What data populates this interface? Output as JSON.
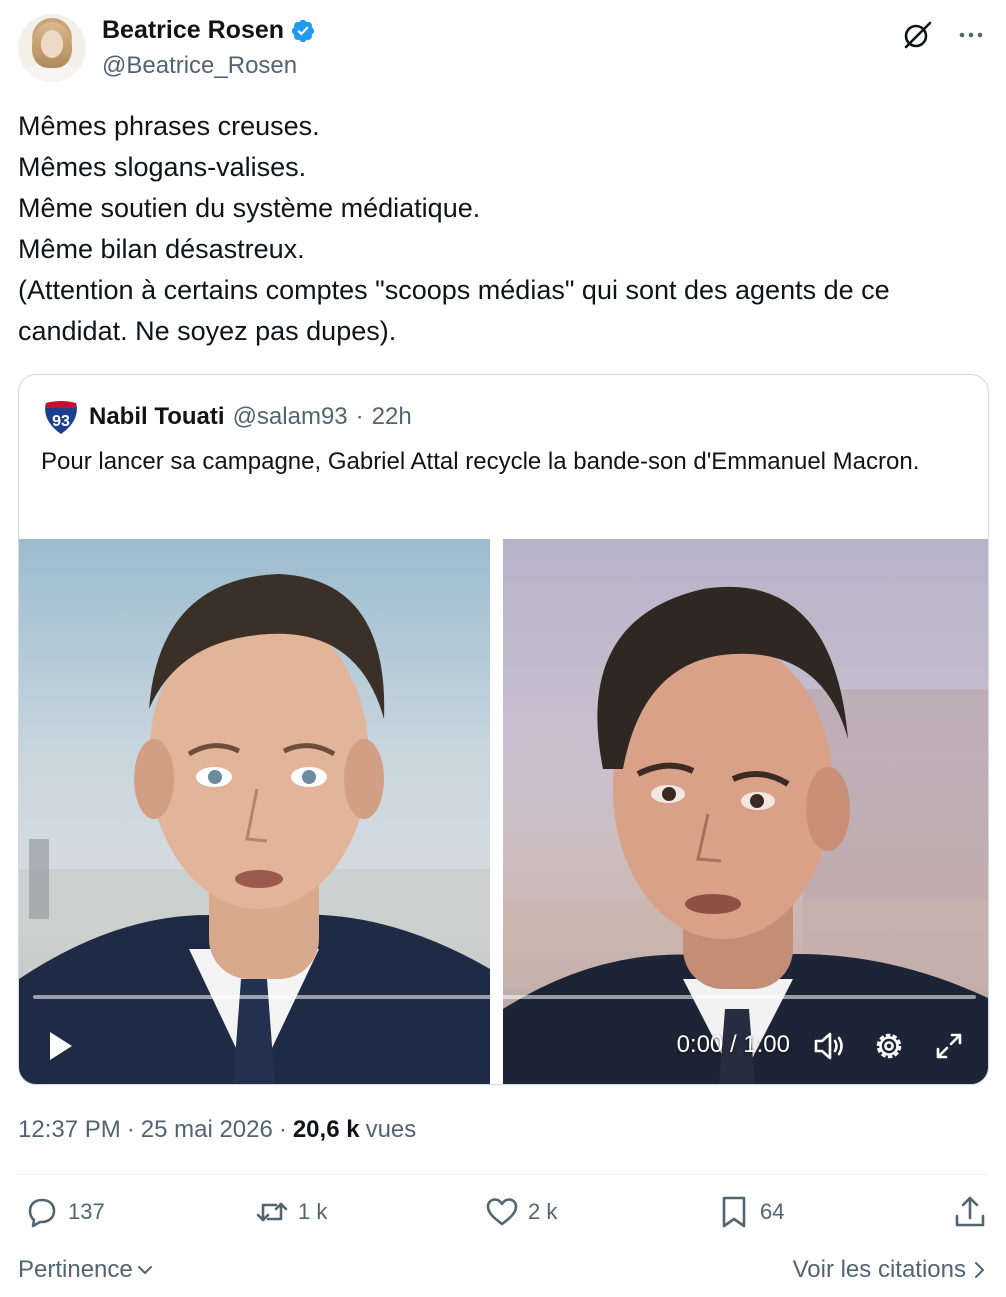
{
  "author": {
    "display_name": "Beatrice Rosen",
    "handle": "@Beatrice_Rosen",
    "verified": true,
    "verified_color": "#1d9bf0"
  },
  "tweet": {
    "text": "Mêmes phrases creuses.\nMêmes slogans-valises.\nMême soutien du système médiatique.\nMême bilan désastreux.\n(Attention à certains comptes \"scoops médias\" qui sont des agents de ce candidat. Ne soyez pas dupes)."
  },
  "quoted_tweet": {
    "badge_text": "93",
    "display_name": "Nabil Touati",
    "handle": "@salam93",
    "separator": "·",
    "age": "22h",
    "text": "Pour lancer sa campagne, Gabriel Attal recycle la bande-son d'Emmanuel Macron.",
    "video": {
      "time": "0:00 / 1:00",
      "progress": 0
    }
  },
  "meta": {
    "time": "12:37 PM",
    "dot1": "·",
    "date": "25 mai 2026",
    "dot2": "·",
    "views_count": "20,6 k",
    "views_label": "vues"
  },
  "actions": {
    "replies": "137",
    "reposts": "1 k",
    "likes": "2 k",
    "bookmarks": "64"
  },
  "footer": {
    "sort_label": "Pertinence",
    "quotes_link": "Voir les citations"
  },
  "icons": {
    "verified": "verified-badge-icon",
    "grok": "grok-icon",
    "more": "more-icon",
    "play": "play-icon",
    "volume": "volume-icon",
    "settings": "gear-icon",
    "fullscreen": "expand-icon",
    "reply": "reply-icon",
    "repost": "repost-icon",
    "like": "heart-icon",
    "bookmark": "bookmark-icon",
    "share": "share-icon"
  }
}
